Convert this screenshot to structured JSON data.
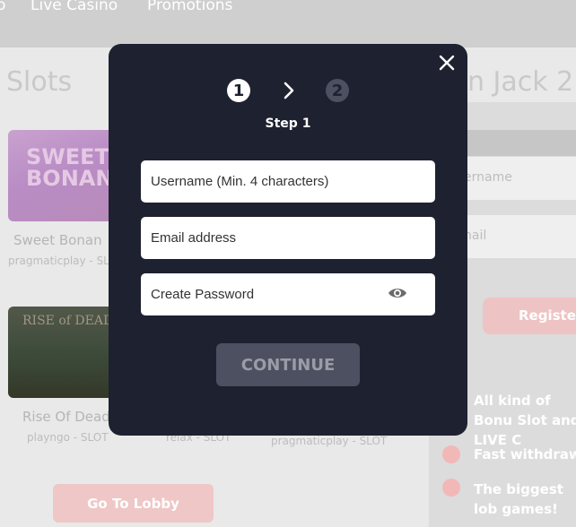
{
  "topnav": {
    "items": [
      "o",
      "Live Casino",
      "Promotions"
    ]
  },
  "section": {
    "left_title": "Slots",
    "right_title": "n Jack 2"
  },
  "games": [
    {
      "name": "Sweet Bonan",
      "meta": "pragmaticplay - SL",
      "thumb_text": "SWEET BONANZA"
    },
    {
      "name": "Rise Of Dead",
      "meta": "playngo - SLOT",
      "thumb_text": "RISE of DEAD"
    },
    {
      "name": "",
      "meta": "relax - SLOT"
    },
    {
      "name": "",
      "meta": "pragmaticplay - SLOT"
    }
  ],
  "lobby_button": "Go To Lobby",
  "register_panel": {
    "username_placeholder": "ername",
    "email_placeholder": "nail",
    "register_button": "Register",
    "features": [
      "All kind of Bonu Slot and LIVE C",
      "Fast withdraw",
      "The biggest lob games!"
    ]
  },
  "modal": {
    "step_current": "1",
    "step_next": "2",
    "step_label": "Step 1",
    "username_placeholder": "Username (Min. 4 characters)",
    "email_placeholder": "Email address",
    "password_placeholder": "Create Password",
    "continue_label": "CONTINUE",
    "colors": {
      "modal_bg": "#1e2130",
      "inactive": "#4d5061",
      "accent_soft": "#eec3c3"
    }
  }
}
